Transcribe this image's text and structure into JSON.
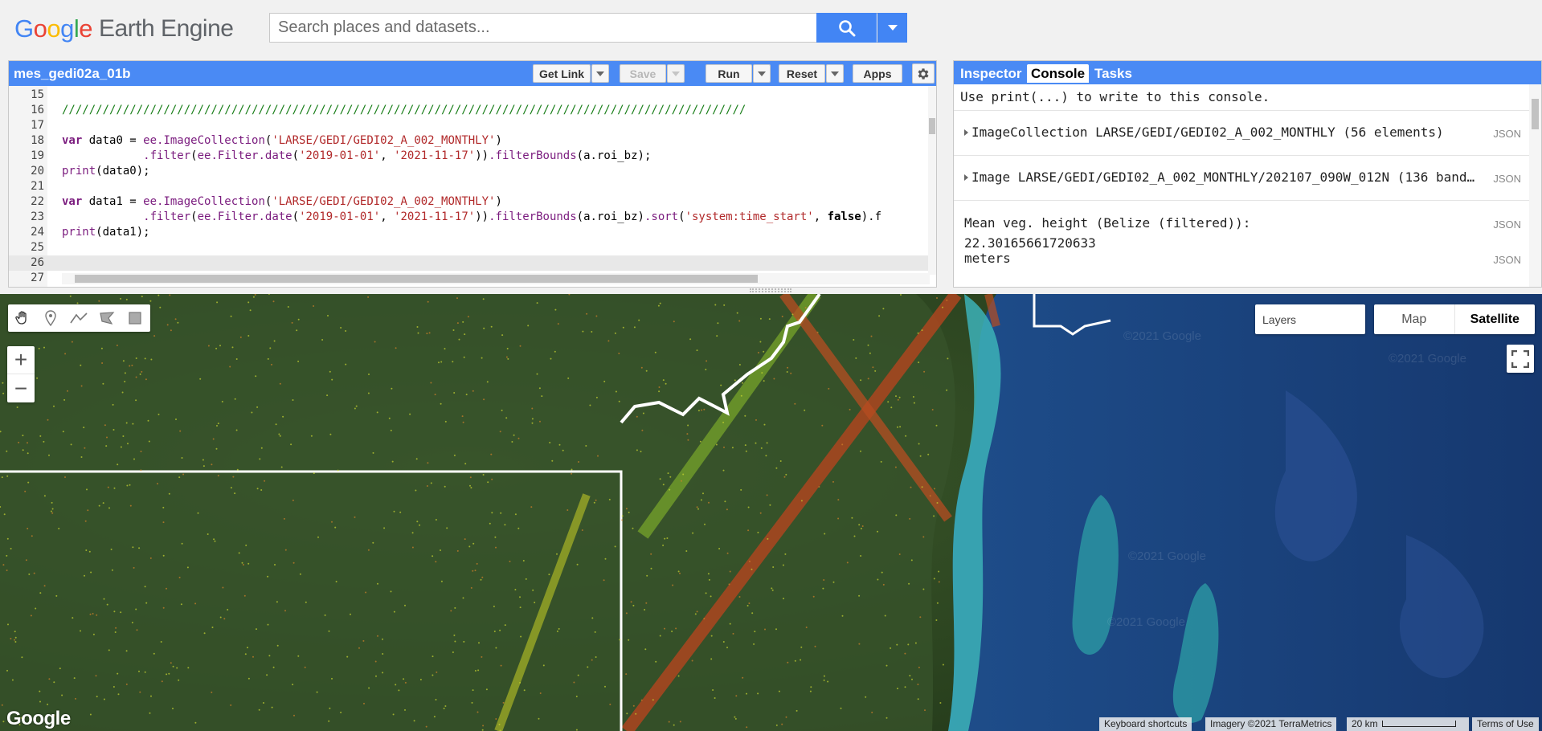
{
  "header": {
    "logo_google": [
      "G",
      "o",
      "o",
      "g",
      "l",
      "e"
    ],
    "logo_product": "Earth Engine",
    "search_placeholder": "Search places and datasets..."
  },
  "editor": {
    "script_name": "mes_gedi02a_01b",
    "toolbar": {
      "get_link": "Get Link",
      "save": "Save",
      "run": "Run",
      "reset": "Reset",
      "apps": "Apps"
    },
    "lines": [
      {
        "num": "15",
        "text": ""
      },
      {
        "num": "16",
        "text": "/////////////////////////////////////////////////////////////////////////////////////////////////////"
      },
      {
        "num": "17",
        "text": ""
      },
      {
        "num": "18",
        "text": "var data0 = ee.ImageCollection('LARSE/GEDI/GEDI02_A_002_MONTHLY')"
      },
      {
        "num": "19",
        "text": "            .filter(ee.Filter.date('2019-01-01', '2021-11-17')).filterBounds(a.roi_bz);"
      },
      {
        "num": "20",
        "text": "print(data0);"
      },
      {
        "num": "21",
        "text": ""
      },
      {
        "num": "22",
        "text": "var data1 = ee.ImageCollection('LARSE/GEDI/GEDI02_A_002_MONTHLY')"
      },
      {
        "num": "23",
        "text": "            .filter(ee.Filter.date('2019-01-01', '2021-11-17')).filterBounds(a.roi_bz).sort('system:time_start', false).f"
      },
      {
        "num": "24",
        "text": "print(data1);"
      },
      {
        "num": "25",
        "text": ""
      },
      {
        "num": "26",
        "text": ""
      },
      {
        "num": "27",
        "text": ""
      }
    ],
    "active_line": "26"
  },
  "side_panel": {
    "tabs": [
      "Inspector",
      "Console",
      "Tasks"
    ],
    "active_tab": "Console",
    "console": {
      "intro": "Use print(...) to write to this console.",
      "entries": [
        {
          "label": "ImageCollection LARSE/GEDI/GEDI02_A_002_MONTHLY (56 elements)",
          "json": "JSON"
        },
        {
          "label": "Image LARSE/GEDI/GEDI02_A_002_MONTHLY/202107_090W_012N (136 band…",
          "json": "JSON"
        }
      ],
      "result": {
        "title": "Mean veg. height (Belize (filtered)):",
        "value": "22.30165661720633",
        "unit": "meters",
        "json": "JSON"
      }
    }
  },
  "map": {
    "layers_label": "Layers",
    "map_types": [
      "Map",
      "Satellite"
    ],
    "active_map_type": "Satellite",
    "zoom_in": "+",
    "zoom_out": "−",
    "google_logo": "Google",
    "attribution": {
      "keyboard": "Keyboard shortcuts",
      "imagery": "Imagery ©2021 TerraMetrics",
      "scale": "20 km",
      "terms": "Terms of Use"
    },
    "watermark": "©2021 Google"
  }
}
